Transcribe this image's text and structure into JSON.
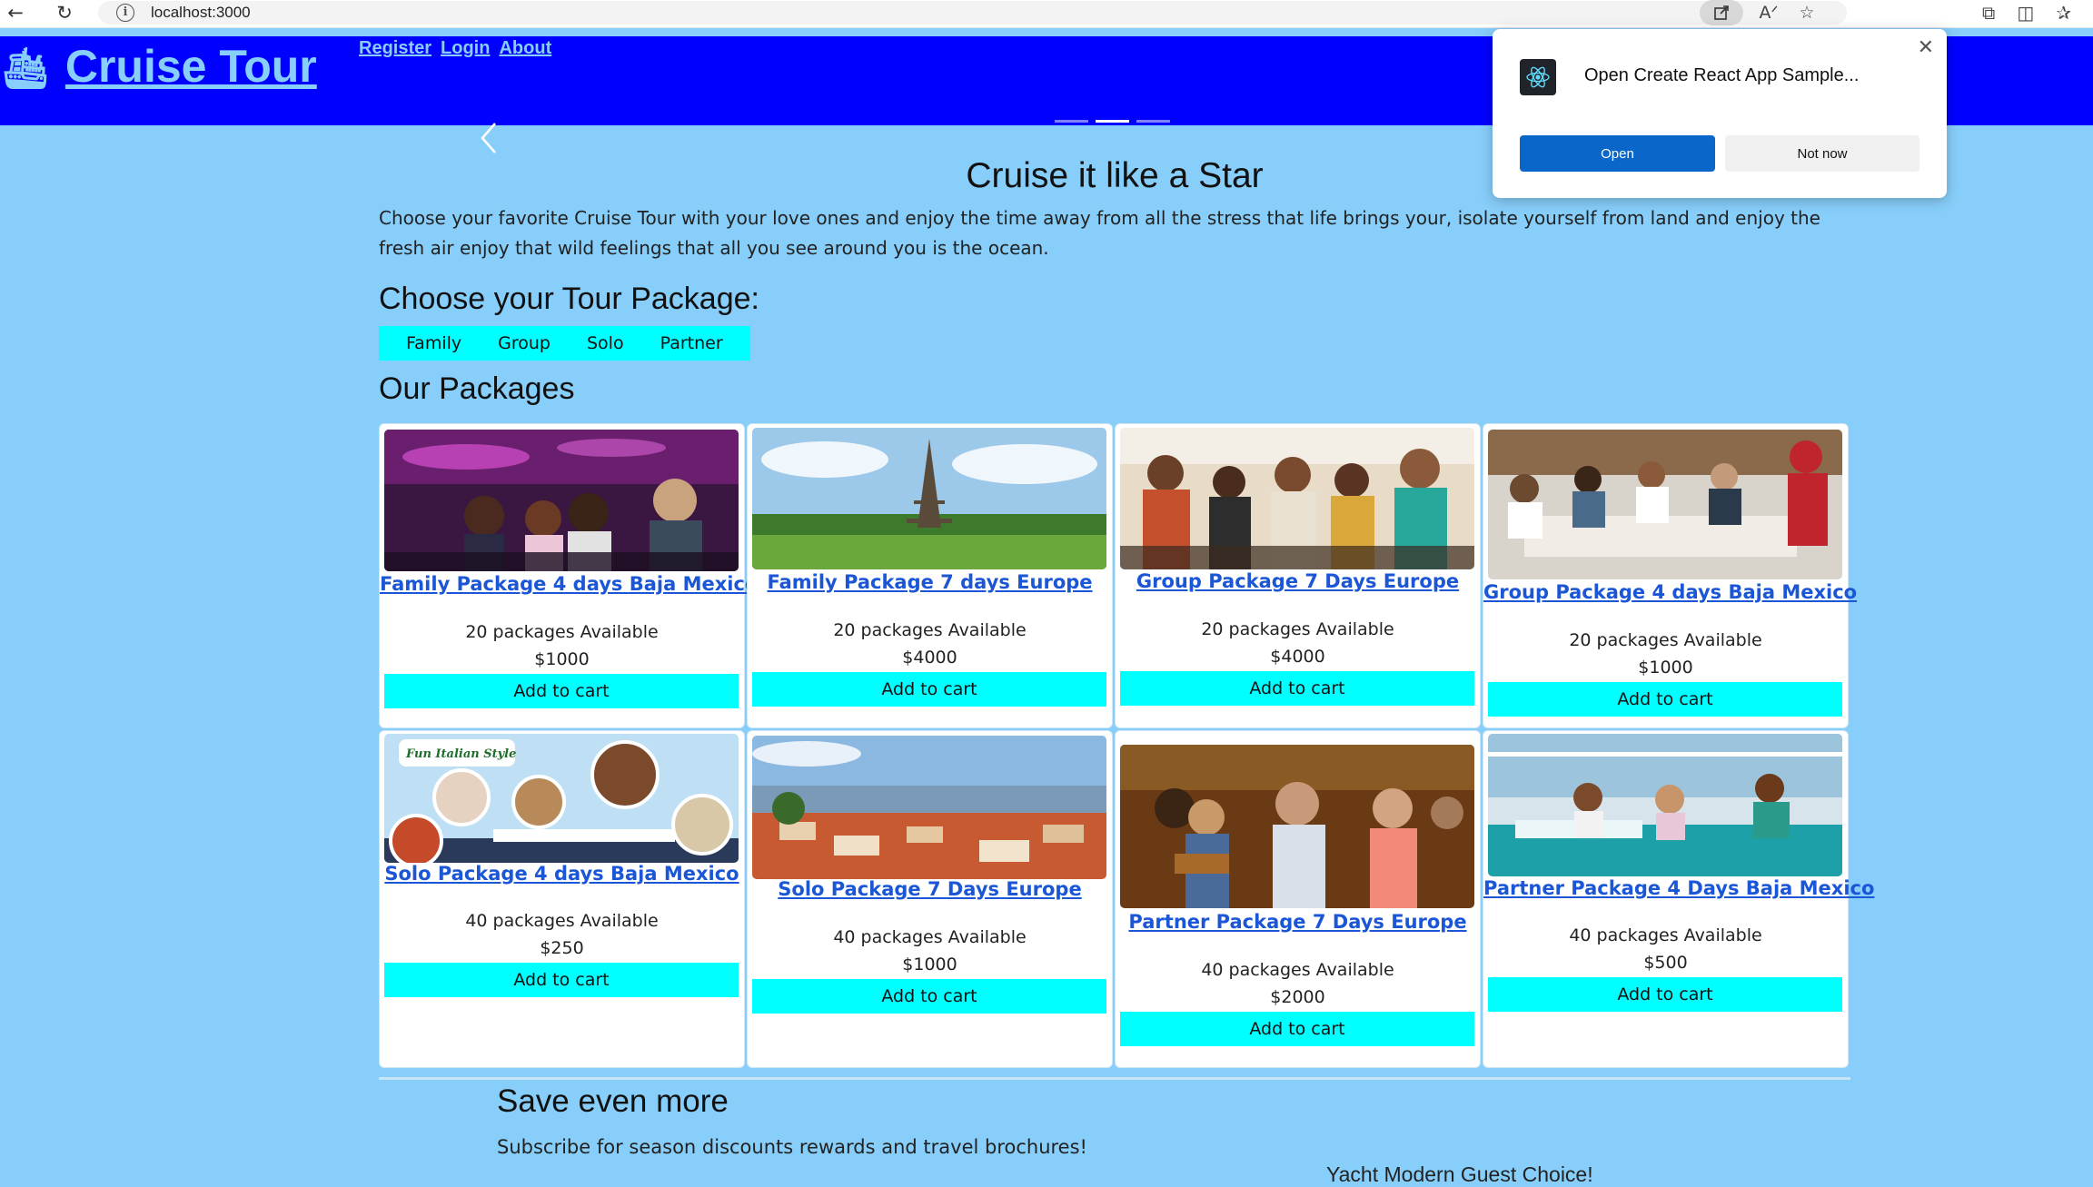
{
  "browser": {
    "url": "localhost:3000",
    "icons": [
      "back-arrow-icon",
      "reload-icon",
      "info-icon",
      "open-in-app-icon",
      "read-aloud-icon",
      "favorite-star-icon",
      "extensions-icon",
      "split-screen-icon"
    ]
  },
  "header": {
    "brand": "Cruise Tour",
    "nav": [
      "Register",
      "Login",
      "About"
    ],
    "bg_color": "#0000ff",
    "link_color": "#87cefa"
  },
  "hero": {
    "title": "Cruise it like a Star",
    "text": "Choose your favorite Cruise Tour with your love ones and enjoy the time away from all the stress that life brings your, isolate yourself from land and enjoy the fresh air enjoy that wild feelings that all you see around you is the ocean."
  },
  "tour_section": {
    "title": "Choose your Tour Package:",
    "tabs": [
      "Family",
      "Group",
      "Solo",
      "Partner"
    ]
  },
  "packages": {
    "title": "Our Packages",
    "cart_label": "Add to cart",
    "items": [
      {
        "title": "Family Package 4 days Baja Mexico",
        "available": "20 packages Available",
        "price": "$1000"
      },
      {
        "title": "Family Package 7 days Europe",
        "available": "20 packages Available",
        "price": "$4000"
      },
      {
        "title": "Group Package 7 Days Europe",
        "available": "20 packages Available",
        "price": "$4000"
      },
      {
        "title": "Group Package 4 days Baja Mexico",
        "available": "20 packages Available",
        "price": "$1000"
      },
      {
        "title": "Solo Package 4 days Baja Mexico",
        "available": "40 packages Available",
        "price": "$250"
      },
      {
        "title": "Solo Package 7 Days Europe",
        "available": "40 packages Available",
        "price": "$1000"
      },
      {
        "title": "Partner Package 7 Days Europe",
        "available": "40 packages Available",
        "price": "$2000"
      },
      {
        "title": "Partner Package 4 Days Baja Mexico",
        "available": "40 packages Available",
        "price": "$500"
      }
    ]
  },
  "image_badges": {
    "italian": "Fun Italian Style"
  },
  "save": {
    "title": "Save even more",
    "text": "Subscribe for season discounts rewards and travel brochures!",
    "cut_text": "Yacht Modern Guest Choice!"
  },
  "popup": {
    "title": "Open Create React App Sample...",
    "open_label": "Open",
    "not_now_label": "Not now"
  },
  "colors": {
    "page_bg": "#87cefa",
    "accent_cyan": "#00ffff",
    "link_blue": "#1a56d6"
  }
}
